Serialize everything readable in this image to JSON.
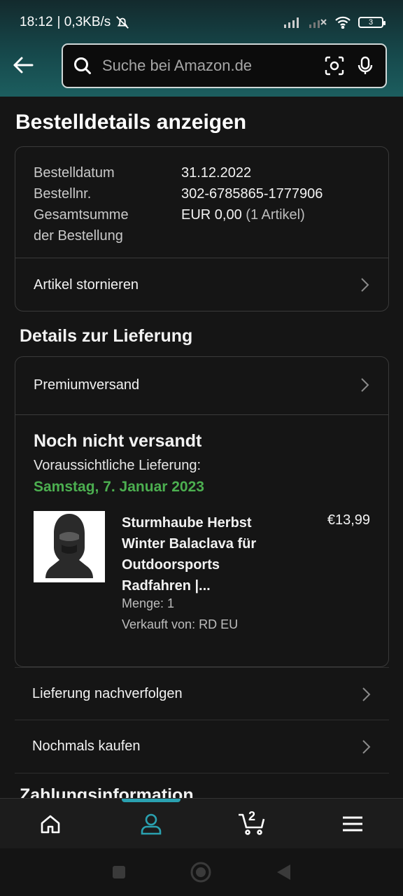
{
  "status_bar": {
    "time": "18:12",
    "net_speed": "| 0,3KB/s",
    "battery_level": "3"
  },
  "header": {
    "search_placeholder": "Suche bei Amazon.de"
  },
  "page_title": "Bestelldetails anzeigen",
  "order": {
    "date_label": "Bestelldatum",
    "date_value": "31.12.2022",
    "number_label": "Bestellnr.",
    "number_value": "302-6785865-1777906",
    "total_label_line1": "Gesamtsumme",
    "total_label_line2": "der Bestellung",
    "total_value": "EUR 0,00",
    "total_items": "(1 Artikel)",
    "cancel_label": "Artikel stornieren"
  },
  "delivery": {
    "section_title": "Details zur Lieferung",
    "shipping_method": "Premiumversand",
    "status": "Noch nicht versandt",
    "expected_label": "Voraussichtliche Lieferung:",
    "expected_date": "Samstag, 7. Januar 2023",
    "expected_date_color": "#4caf50",
    "product": {
      "title": "Sturmhaube Herbst Winter Balaclava für Outdoorsports Radfahren |...",
      "price": "€13,99",
      "quantity": "Menge: 1",
      "seller": "Verkauft von: RD EU"
    }
  },
  "actions": {
    "track": "Lieferung nachverfolgen",
    "buy_again": "Nochmals kaufen"
  },
  "next_section_peek": "Zahlungsinformation",
  "bottom_nav": {
    "cart_count": "2",
    "active_tab": "account",
    "accent_color": "#2aa1b0"
  }
}
